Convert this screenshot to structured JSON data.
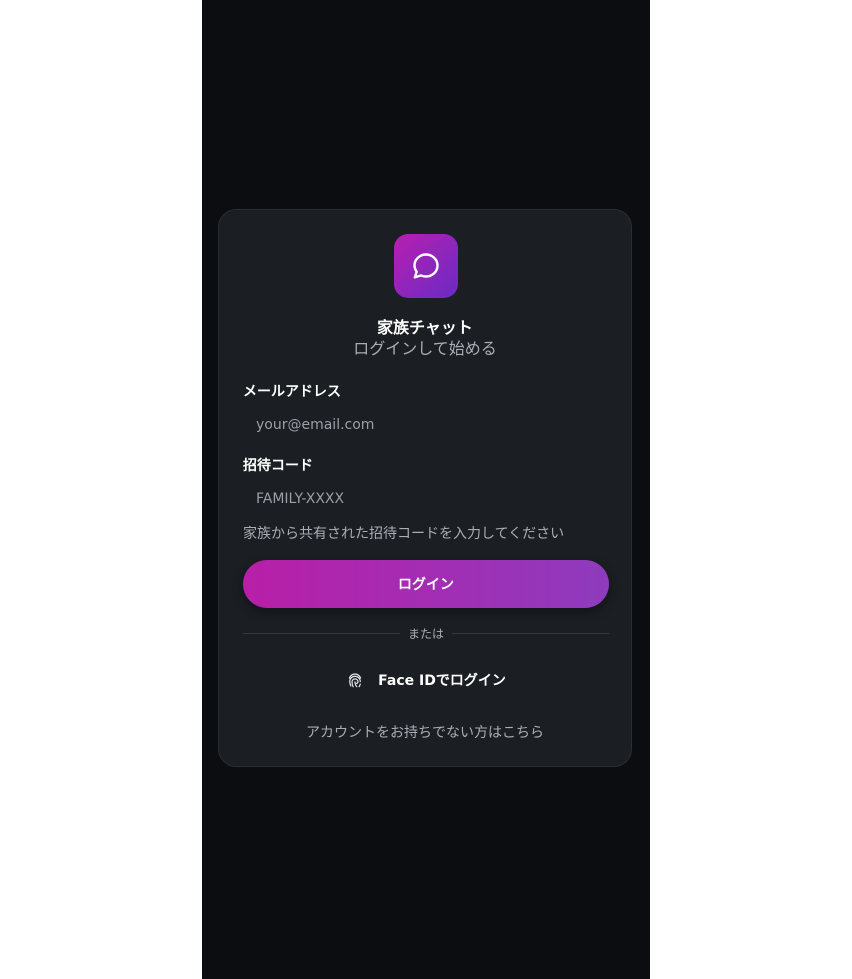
{
  "app": {
    "title": "家族チャット",
    "subtitle": "ログインして始める",
    "icon": "chat-bubble-icon",
    "accent_start": "#b81fb0",
    "accent_end": "#6a2bc4"
  },
  "form": {
    "email_label": "メールアドレス",
    "email_placeholder": "your@email.com",
    "email_value": "",
    "invite_label": "招待コード",
    "invite_placeholder": "FAMILY-XXXX",
    "invite_value": "",
    "invite_hint": "家族から共有された招待コードを入力してください",
    "login_button": "ログイン"
  },
  "divider": {
    "text": "または"
  },
  "face_id": {
    "icon": "fingerprint-icon",
    "label": "Face IDでログイン"
  },
  "footer": {
    "signup_link": "アカウントをお持ちでない方はこちら"
  }
}
